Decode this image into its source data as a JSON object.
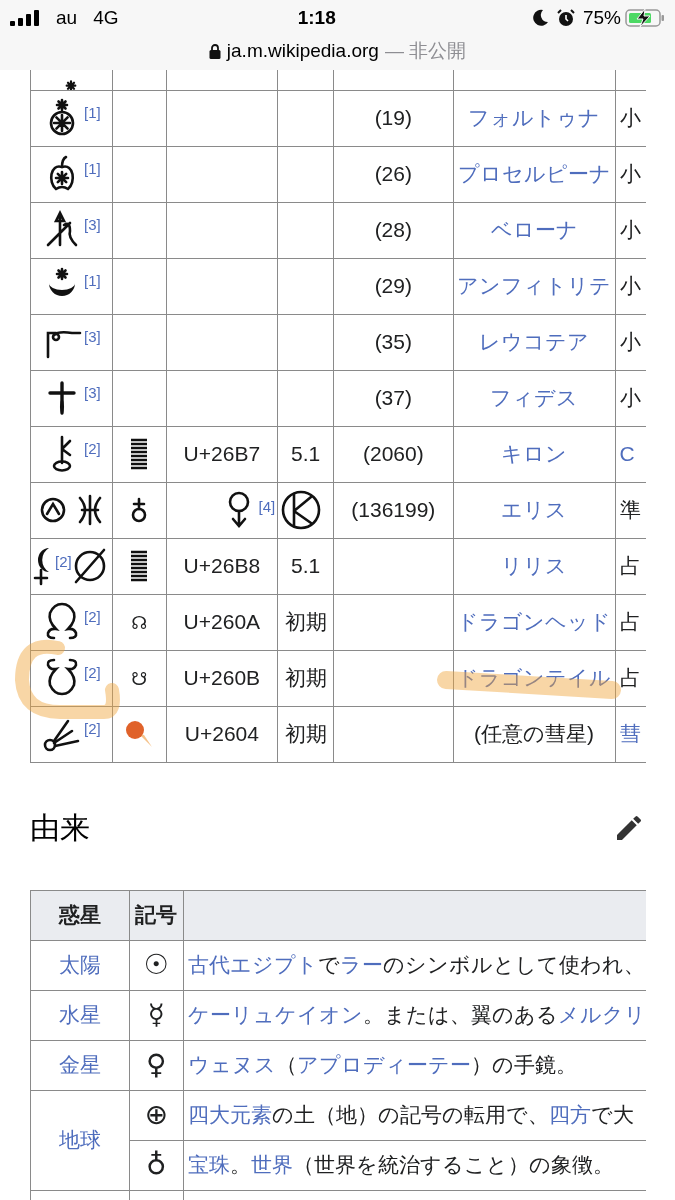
{
  "status_bar": {
    "carrier": "au",
    "network": "4G",
    "time": "1:18",
    "battery": "75%"
  },
  "address_bar": {
    "url": "ja.m.wikipedia.org",
    "suffix": "— 非公開"
  },
  "symbols_table": {
    "rows": [
      {
        "ref": "[1]",
        "glyph": "",
        "code": "",
        "version": "",
        "number": "(19)",
        "name": {
          "text": "フォルトゥナ",
          "link": true
        },
        "extra": {
          "text": "小",
          "link": false
        }
      },
      {
        "ref": "[1]",
        "glyph": "",
        "code": "",
        "version": "",
        "number": "(26)",
        "name": {
          "text": "プロセルピーナ",
          "link": true
        },
        "extra": {
          "text": "小",
          "link": false
        }
      },
      {
        "ref": "[3]",
        "glyph": "",
        "code": "",
        "version": "",
        "number": "(28)",
        "name": {
          "text": "ベローナ",
          "link": true
        },
        "extra": {
          "text": "小",
          "link": false
        }
      },
      {
        "ref": "[1]",
        "glyph": "",
        "code": "",
        "version": "",
        "number": "(29)",
        "name": {
          "text": "アンフィトリテ",
          "link": true
        },
        "extra": {
          "text": "小",
          "link": false
        }
      },
      {
        "ref": "[3]",
        "glyph": "",
        "code": "",
        "version": "",
        "number": "(35)",
        "name": {
          "text": "レウコテア",
          "link": true
        },
        "extra": {
          "text": "小",
          "link": false
        }
      },
      {
        "ref": "[3]",
        "glyph": "",
        "code": "",
        "version": "",
        "number": "(37)",
        "name": {
          "text": "フィデス",
          "link": true
        },
        "extra": {
          "text": "小",
          "link": false
        }
      },
      {
        "ref": "[2]",
        "glyph": "",
        "code": "U+26B7",
        "version": "5.1",
        "number": "(2060)",
        "name": {
          "text": "キロン",
          "link": true
        },
        "extra": {
          "text": "C",
          "link": true
        }
      },
      {
        "ref": "[4]",
        "glyph": "",
        "code": "",
        "version": "",
        "number": "(136199)",
        "name": {
          "text": "エリス",
          "link": true
        },
        "extra": {
          "text": "準",
          "link": false
        }
      },
      {
        "ref": "[2]",
        "glyph": "",
        "code": "U+26B8",
        "version": "5.1",
        "number": "",
        "name": {
          "text": "リリス",
          "link": true
        },
        "extra": {
          "text": "占",
          "link": false
        }
      },
      {
        "ref": "[2]",
        "glyph": "☊",
        "code": "U+260A",
        "version": "初期",
        "number": "",
        "name": {
          "text": "ドラゴンヘッド",
          "link": true
        },
        "extra": {
          "text": "占",
          "link": false
        }
      },
      {
        "ref": "[2]",
        "glyph": "☋",
        "code": "U+260B",
        "version": "初期",
        "number": "",
        "name": {
          "text": "ドラゴンテイル",
          "link": true
        },
        "extra": {
          "text": "占",
          "link": false
        }
      },
      {
        "ref": "[2]",
        "glyph": "",
        "code": "U+2604",
        "version": "初期",
        "number": "",
        "name": {
          "text": "(任意の彗星)",
          "link": false
        },
        "extra": {
          "text": "彗",
          "link": true
        }
      }
    ]
  },
  "section": {
    "heading": "由来"
  },
  "origin_table": {
    "columns": [
      "惑星",
      "記号"
    ],
    "rows": [
      {
        "planet": "太陽",
        "entries": [
          {
            "symbol": "☉",
            "description": [
              {
                "text": "古代エジプト",
                "link": true
              },
              {
                "text": "で",
                "link": false
              },
              {
                "text": "ラー",
                "link": true
              },
              {
                "text": "のシンボルとして使われ、",
                "link": false
              }
            ]
          }
        ]
      },
      {
        "planet": "水星",
        "entries": [
          {
            "symbol": "☿",
            "description": [
              {
                "text": "ケーリュケイオン",
                "link": true
              },
              {
                "text": "。または、翼のある",
                "link": false
              },
              {
                "text": "メルクリ",
                "link": true
              }
            ]
          }
        ]
      },
      {
        "planet": "金星",
        "entries": [
          {
            "symbol": "♀",
            "description": [
              {
                "text": "ウェヌス",
                "link": true
              },
              {
                "text": "（",
                "link": false
              },
              {
                "text": "アプロディーテー",
                "link": true
              },
              {
                "text": "）の手鏡。",
                "link": false
              }
            ]
          }
        ]
      },
      {
        "planet": "地球",
        "entries": [
          {
            "symbol": "⊕",
            "description": [
              {
                "text": "四大元素",
                "link": true
              },
              {
                "text": "の土（地）の記号の転用で、",
                "link": false
              },
              {
                "text": "四方",
                "link": true
              },
              {
                "text": "で大",
                "link": false
              }
            ]
          },
          {
            "symbol": "♁",
            "description": [
              {
                "text": "宝珠",
                "link": true
              },
              {
                "text": "。",
                "link": false
              },
              {
                "text": "世界",
                "link": true
              },
              {
                "text": "（世界を統治すること）の象徴。",
                "link": false
              }
            ]
          }
        ]
      }
    ]
  }
}
